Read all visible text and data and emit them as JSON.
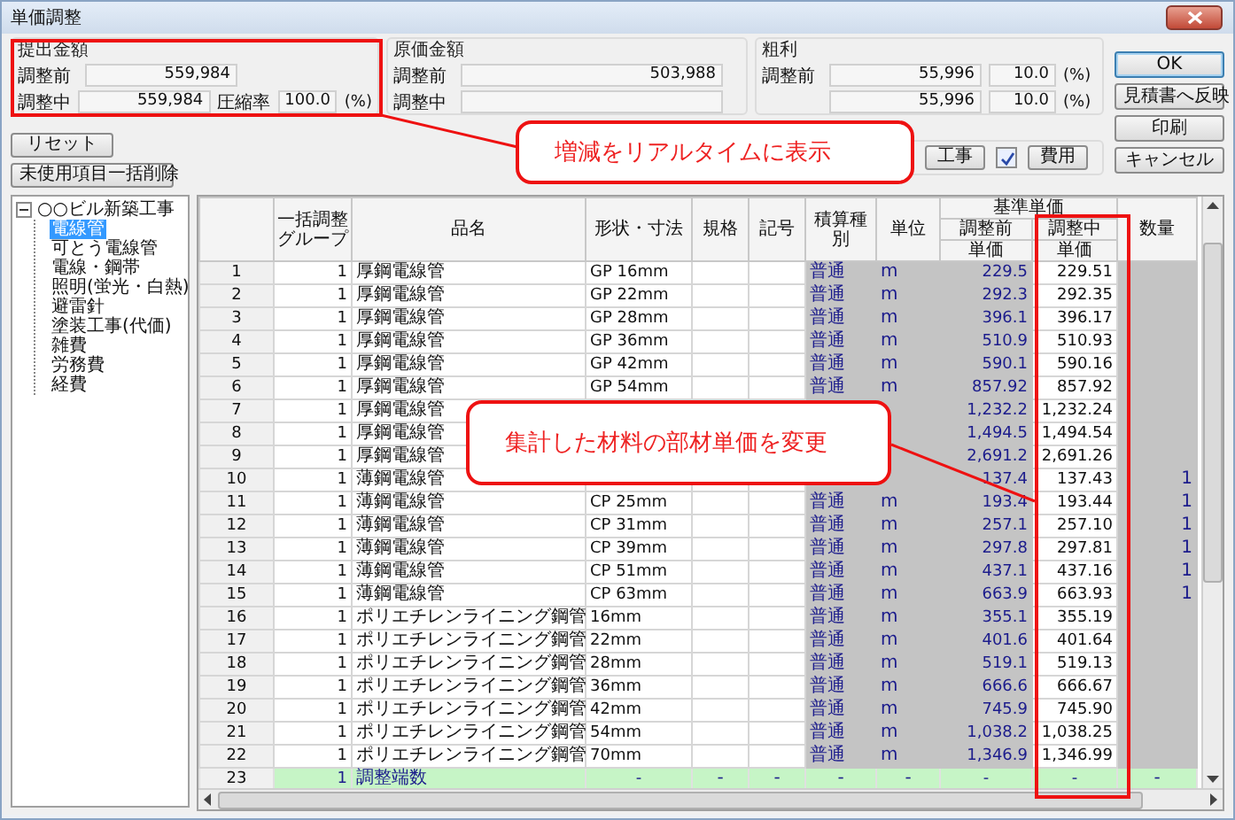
{
  "window": {
    "title": "単価調整"
  },
  "summary_groups": [
    {
      "title": "提出金額",
      "rows": [
        {
          "label": "調整前",
          "value": "559,984"
        },
        {
          "label": "調整中",
          "value": "559,984",
          "extra_label": "圧縮率",
          "extra_value": "100.0",
          "unit": "(%)"
        }
      ]
    },
    {
      "title": "原価金額",
      "rows": [
        {
          "label": "調整前",
          "value": "503,988"
        },
        {
          "label": "調整中"
        }
      ]
    },
    {
      "title": "粗利",
      "rows": [
        {
          "label": "調整前",
          "value": "55,996",
          "percent": "10.0",
          "unit": "(%)"
        },
        {
          "value": "55,996",
          "percent": "10.0",
          "unit": "(%)"
        }
      ]
    }
  ],
  "left_buttons": [
    {
      "label": "リセット"
    },
    {
      "label": "未使用項目一括削除"
    }
  ],
  "filter_bar": [
    {
      "kind": "button",
      "label": "工事"
    },
    {
      "kind": "checkbox",
      "checked": true
    },
    {
      "kind": "button",
      "label": "費用"
    }
  ],
  "buttons": [
    {
      "label": "OK",
      "default": true
    },
    {
      "label": "見積書へ反映",
      "default": false
    },
    {
      "label": "印刷",
      "default": false
    },
    {
      "label": "キャンセル",
      "default": false
    }
  ],
  "tree": {
    "label": "○○ビル新築工事",
    "expanded": true,
    "selected": false,
    "children": [
      {
        "label": "電線管",
        "selected": true
      },
      {
        "label": "可とう電線管",
        "selected": false
      },
      {
        "label": "電線・鋼帯",
        "selected": false
      },
      {
        "label": "照明(蛍光・白熱)",
        "selected": false
      },
      {
        "label": "避雷針",
        "selected": false
      },
      {
        "label": "塗装工事(代価)",
        "selected": false
      },
      {
        "label": "雑費",
        "selected": false
      },
      {
        "label": "労務費",
        "selected": false
      },
      {
        "label": "経費",
        "selected": false
      }
    ]
  },
  "table": {
    "header": {
      "group": "一括調整グループ",
      "name": "品名",
      "size": "形状・寸法",
      "spec": "規格",
      "mark": "記号",
      "type": "積算種別",
      "unit": "単位",
      "base_price": "基準単価",
      "before": "調整前",
      "during": "調整中",
      "before_sub": "単価",
      "during_sub": "単価",
      "qty": "数量"
    },
    "rows": [
      {
        "kind": "item",
        "no": "1",
        "group": "1",
        "name": "厚鋼電線管",
        "size": "GP 16mm",
        "type": "普通",
        "unit": "m",
        "before": "229.5",
        "during": "229.51"
      },
      {
        "kind": "item",
        "no": "2",
        "group": "1",
        "name": "厚鋼電線管",
        "size": "GP 22mm",
        "type": "普通",
        "unit": "m",
        "before": "292.3",
        "during": "292.35"
      },
      {
        "kind": "item",
        "no": "3",
        "group": "1",
        "name": "厚鋼電線管",
        "size": "GP 28mm",
        "type": "普通",
        "unit": "m",
        "before": "396.1",
        "during": "396.17"
      },
      {
        "kind": "item",
        "no": "4",
        "group": "1",
        "name": "厚鋼電線管",
        "size": "GP 36mm",
        "type": "普通",
        "unit": "m",
        "before": "510.9",
        "during": "510.93"
      },
      {
        "kind": "item",
        "no": "5",
        "group": "1",
        "name": "厚鋼電線管",
        "size": "GP 42mm",
        "type": "普通",
        "unit": "m",
        "before": "590.1",
        "during": "590.16"
      },
      {
        "kind": "item",
        "no": "6",
        "group": "1",
        "name": "厚鋼電線管",
        "size": "GP 54mm",
        "type": "普通",
        "unit": "m",
        "before": "857.92",
        "during": "857.92"
      },
      {
        "kind": "item",
        "no": "7",
        "group": "1",
        "name": "厚鋼電線管",
        "before": "1,232.2",
        "during": "1,232.24"
      },
      {
        "kind": "item",
        "no": "8",
        "group": "1",
        "name": "厚鋼電線管",
        "before": "1,494.5",
        "during": "1,494.54"
      },
      {
        "kind": "item",
        "no": "9",
        "group": "1",
        "name": "厚鋼電線管",
        "before": "2,691.2",
        "during": "2,691.26"
      },
      {
        "kind": "item",
        "no": "10",
        "group": "1",
        "name": "薄鋼電線管",
        "before": "137.4",
        "during": "137.43",
        "qty": "1"
      },
      {
        "kind": "item",
        "no": "11",
        "group": "1",
        "name": "薄鋼電線管",
        "size": "CP 25mm",
        "type": "普通",
        "unit": "m",
        "before": "193.4",
        "during": "193.44",
        "qty": "1"
      },
      {
        "kind": "item",
        "no": "12",
        "group": "1",
        "name": "薄鋼電線管",
        "size": "CP 31mm",
        "type": "普通",
        "unit": "m",
        "before": "257.1",
        "during": "257.10",
        "qty": "1"
      },
      {
        "kind": "item",
        "no": "13",
        "group": "1",
        "name": "薄鋼電線管",
        "size": "CP 39mm",
        "type": "普通",
        "unit": "m",
        "before": "297.8",
        "during": "297.81",
        "qty": "1"
      },
      {
        "kind": "item",
        "no": "14",
        "group": "1",
        "name": "薄鋼電線管",
        "size": "CP 51mm",
        "type": "普通",
        "unit": "m",
        "before": "437.1",
        "during": "437.16",
        "qty": "1"
      },
      {
        "kind": "item",
        "no": "15",
        "group": "1",
        "name": "薄鋼電線管",
        "size": "CP 63mm",
        "type": "普通",
        "unit": "m",
        "before": "663.9",
        "during": "663.93",
        "qty": "1"
      },
      {
        "kind": "item",
        "no": "16",
        "group": "1",
        "name": "ポリエチレンライニング鋼管",
        "size": "16mm",
        "type": "普通",
        "unit": "m",
        "before": "355.1",
        "during": "355.19"
      },
      {
        "kind": "item",
        "no": "17",
        "group": "1",
        "name": "ポリエチレンライニング鋼管",
        "size": "22mm",
        "type": "普通",
        "unit": "m",
        "before": "401.6",
        "during": "401.64"
      },
      {
        "kind": "item",
        "no": "18",
        "group": "1",
        "name": "ポリエチレンライニング鋼管",
        "size": "28mm",
        "type": "普通",
        "unit": "m",
        "before": "519.1",
        "during": "519.13"
      },
      {
        "kind": "item",
        "no": "19",
        "group": "1",
        "name": "ポリエチレンライニング鋼管",
        "size": "36mm",
        "type": "普通",
        "unit": "m",
        "before": "666.6",
        "during": "666.67"
      },
      {
        "kind": "item",
        "no": "20",
        "group": "1",
        "name": "ポリエチレンライニング鋼管",
        "size": "42mm",
        "type": "普通",
        "unit": "m",
        "before": "745.9",
        "during": "745.90"
      },
      {
        "kind": "item",
        "no": "21",
        "group": "1",
        "name": "ポリエチレンライニング鋼管",
        "size": "54mm",
        "type": "普通",
        "unit": "m",
        "before": "1,038.2",
        "during": "1,038.25"
      },
      {
        "kind": "item",
        "no": "22",
        "group": "1",
        "name": "ポリエチレンライニング鋼管",
        "size": "70mm",
        "type": "普通",
        "unit": "m",
        "before": "1,346.9",
        "during": "1,346.99"
      },
      {
        "kind": "adjustment",
        "no": "23",
        "group": "1",
        "name": "調整端数",
        "size": "-",
        "spec": "-",
        "mark": "-",
        "type": "-",
        "unit": "-",
        "before": "-",
        "during": "-",
        "qty": "-"
      }
    ]
  },
  "callouts": [
    {
      "text": "増減をリアルタイムに表示"
    },
    {
      "text": "集計した材料の部材単価を変更"
    }
  ]
}
